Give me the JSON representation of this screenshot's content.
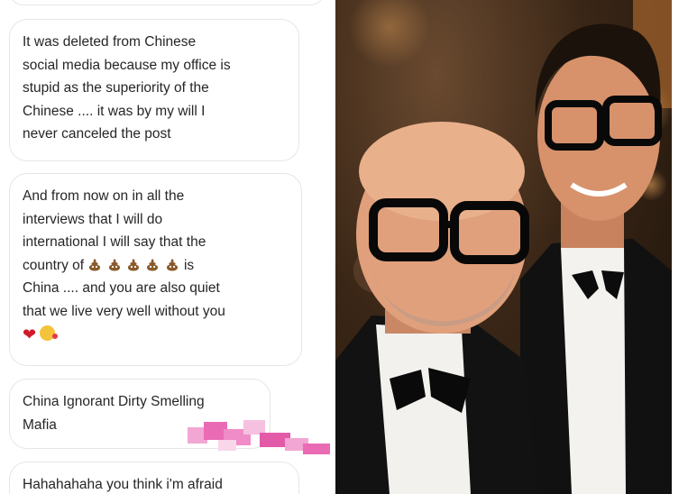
{
  "conversation": {
    "messages": [
      {
        "lines": [
          "It was deleted from Chinese",
          "social media because my office is",
          "stupid as the superiority of the",
          "Chinese .... it was by my will I",
          "never canceled the post"
        ]
      },
      {
        "lines_before_emoji": [
          "And from now on in all the",
          "interviews that I will do",
          "international I will say that the"
        ],
        "emoji_line_prefix": "country of",
        "emoji_line_suffix": "is",
        "lines_after_emoji": [
          "China .... and you are also quiet",
          "that we live very well without you"
        ],
        "emoji_row": [
          "red-heart",
          "face-blowing-kiss"
        ],
        "inline_emoji": [
          "pile-of-poo",
          "pile-of-poo",
          "pile-of-poo",
          "pile-of-poo",
          "pile-of-poo"
        ]
      },
      {
        "lines": [
          "China Ignorant Dirty Smelling",
          "Mafia"
        ]
      },
      {
        "lines": [
          "Hahahahaha you think i'm afraid"
        ]
      }
    ],
    "redacted": "pixelated-username"
  },
  "photo": {
    "subject": "two men in black glasses and bow ties"
  },
  "colors": {
    "bubble_border": "#e6e6e6",
    "text": "#262626",
    "pixelation_pink": "#e96bb4"
  }
}
